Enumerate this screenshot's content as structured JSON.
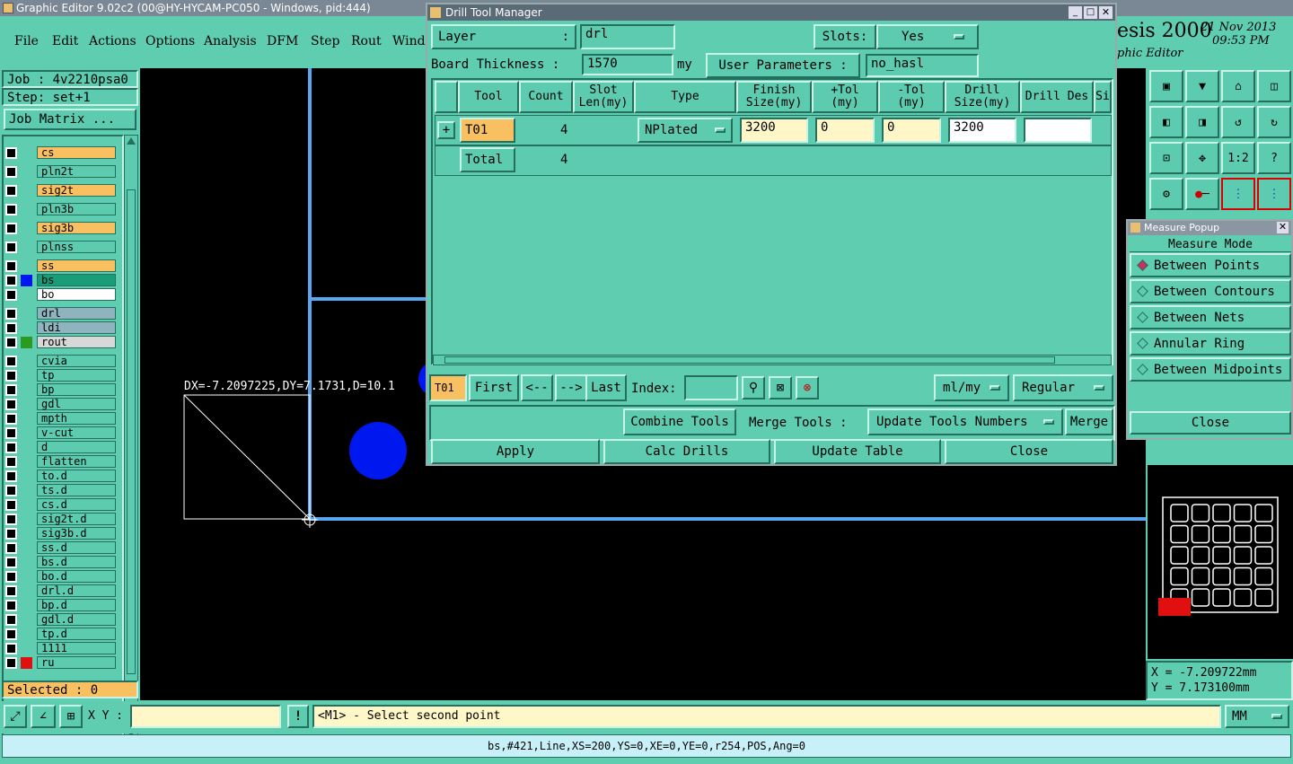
{
  "window_title": "Graphic Editor 9.02c2 (00@HY-HYCAM-PC050 - Windows, pid:444)",
  "menu": [
    "File",
    "Edit",
    "Actions",
    "Options",
    "Analysis",
    "DFM",
    "Step",
    "Rout",
    "Windo"
  ],
  "brand": {
    "name": "esis 2000",
    "sub": "phic Editor",
    "date": "21 Nov 2013",
    "time": "09:53 PM"
  },
  "left": {
    "job": "Job : 4v2210psa0",
    "step": "Step: set+1",
    "job_matrix": "Job Matrix ...",
    "selected": "Selected : 0",
    "layers": [
      {
        "name": "cs",
        "color": "#f8c060"
      },
      {
        "name": "pln2t",
        "color": "#5ccbaf"
      },
      {
        "name": "sig2t",
        "color": "#f8c060"
      },
      {
        "name": "pln3b",
        "color": "#5ccbaf"
      },
      {
        "name": "sig3b",
        "color": "#f8c060"
      },
      {
        "name": "plnss",
        "color": "#5ccbaf"
      },
      {
        "name": "ss",
        "color": "#f8c060"
      },
      {
        "name": "bs",
        "color": "#1a9c78"
      },
      {
        "name": "bo",
        "color": "#ffffff"
      },
      {
        "name": "drl",
        "color": "#8fb4c0"
      },
      {
        "name": "ldi",
        "color": "#8fb4c0"
      },
      {
        "name": "rout",
        "color": "#d8d8d8"
      },
      {
        "name": "cvia",
        "color": "#5ccbaf"
      },
      {
        "name": "tp",
        "color": "#5ccbaf"
      },
      {
        "name": "bp",
        "color": "#5ccbaf"
      },
      {
        "name": "gdl",
        "color": "#5ccbaf"
      },
      {
        "name": "mpth",
        "color": "#5ccbaf"
      },
      {
        "name": "v-cut",
        "color": "#5ccbaf"
      },
      {
        "name": "d",
        "color": "#5ccbaf"
      },
      {
        "name": "flatten",
        "color": "#5ccbaf"
      },
      {
        "name": "to.d",
        "color": "#5ccbaf"
      },
      {
        "name": "ts.d",
        "color": "#5ccbaf"
      },
      {
        "name": "cs.d",
        "color": "#5ccbaf"
      },
      {
        "name": "sig2t.d",
        "color": "#5ccbaf"
      },
      {
        "name": "sig3b.d",
        "color": "#5ccbaf"
      },
      {
        "name": "ss.d",
        "color": "#5ccbaf"
      },
      {
        "name": "bs.d",
        "color": "#5ccbaf"
      },
      {
        "name": "bo.d",
        "color": "#5ccbaf"
      },
      {
        "name": "drl.d",
        "color": "#5ccbaf"
      },
      {
        "name": "bp.d",
        "color": "#5ccbaf"
      },
      {
        "name": "gdl.d",
        "color": "#5ccbaf"
      },
      {
        "name": "tp.d",
        "color": "#5ccbaf"
      },
      {
        "name": "1111",
        "color": "#5ccbaf"
      },
      {
        "name": "ru",
        "color": "#5ccbaf"
      }
    ]
  },
  "canvas": {
    "measure_text": "DX=-7.2097225,DY=7.1731,D=10.1"
  },
  "drill": {
    "title": "Drill Tool Manager",
    "layer_label": "Layer",
    "layer_colon": ":",
    "layer_value": "drl",
    "slots_label": "Slots:",
    "slots_value": "Yes",
    "board_label": "Board Thickness :",
    "board_value": "1570",
    "board_unit": "my",
    "user_params": "User Parameters :",
    "user_value": "no_hasl",
    "headers": [
      "Tool",
      "Count",
      "Slot Len(my)",
      "Type",
      "Finish Size(my)",
      "+Tol (my)",
      "-Tol (my)",
      "Drill Size(my)",
      "Drill Des",
      "Si"
    ],
    "row1": {
      "tool": "T01",
      "count": "4",
      "type": "NPlated",
      "finish": "3200",
      "ptol": "0",
      "mtol": "0",
      "drill": "3200",
      "des": ""
    },
    "row2": {
      "tool": "Total",
      "count": "4"
    },
    "nav": {
      "current": "T01",
      "first": "First",
      "prev": "<--",
      "next": "-->",
      "last": "Last",
      "index": "Index:",
      "unit": "ml/my",
      "mode": "Regular"
    },
    "actions": {
      "combine": "Combine Tools",
      "merge_tools": "Merge Tools :",
      "update_nums": "Update Tools Numbers",
      "merge": "Merge"
    },
    "bottom": {
      "apply": "Apply",
      "calc": "Calc Drills",
      "update": "Update Table",
      "close": "Close"
    }
  },
  "measure": {
    "title": "Measure Popup",
    "mode": "Measure Mode",
    "items": [
      "Between Points",
      "Between Contours",
      "Between Nets",
      "Annular Ring",
      "Between Midpoints"
    ],
    "close": "Close"
  },
  "coords": {
    "x": "X = -7.209722mm",
    "y": "Y = 7.173100mm"
  },
  "bottom": {
    "xy_label": "X Y :",
    "prompt": "<M1> - Select second point",
    "unit": "MM",
    "status": "bs,#421,Line,XS=200,YS=0,XE=0,YE=0,r254,POS,Ang=0"
  }
}
